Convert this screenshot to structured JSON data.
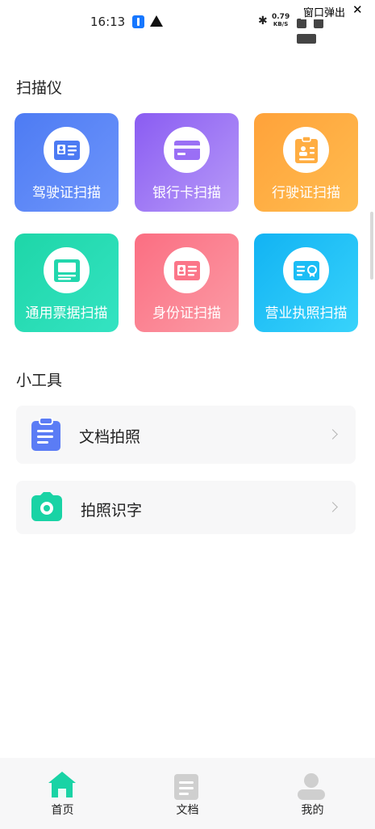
{
  "status_bar": {
    "time": "16:13",
    "net_speed_value": "0.79",
    "net_speed_unit": "KB/S",
    "popup_label": "窗口弹出",
    "popup_close": "✕"
  },
  "scanner_section": {
    "title": "扫描仪",
    "cards": [
      {
        "label": "驾驶证扫描",
        "icon": "driver-license-icon",
        "colors": [
          "#4d7bf3",
          "#6f96fb"
        ]
      },
      {
        "label": "银行卡扫描",
        "icon": "bank-card-icon",
        "colors": [
          "#8a5cf2",
          "#b79af8"
        ]
      },
      {
        "label": "行驶证扫描",
        "icon": "vehicle-license-icon",
        "colors": [
          "#ffa23a",
          "#ffbc4f"
        ]
      },
      {
        "label": "通用票据扫描",
        "icon": "receipt-icon",
        "colors": [
          "#1ed6a8",
          "#34e3c2"
        ]
      },
      {
        "label": "身份证扫描",
        "icon": "id-card-icon",
        "colors": [
          "#fb6e82",
          "#fb9ba5"
        ]
      },
      {
        "label": "营业执照扫描",
        "icon": "business-license-icon",
        "colors": [
          "#12b3f3",
          "#38d3fb"
        ]
      }
    ]
  },
  "tools_section": {
    "title": "小工具",
    "items": [
      {
        "label": "文档拍照",
        "icon": "clipboard-document-icon"
      },
      {
        "label": "拍照识字",
        "icon": "camera-icon"
      }
    ]
  },
  "tabbar": {
    "tabs": [
      {
        "label": "首页",
        "icon": "home-icon",
        "active": true
      },
      {
        "label": "文档",
        "icon": "document-icon",
        "active": false
      },
      {
        "label": "我的",
        "icon": "profile-icon",
        "active": false
      }
    ]
  },
  "colors": {
    "accent_green": "#19d3a5",
    "inactive_gray": "#cfcfcf",
    "tool_blue": "#5b7cf5"
  }
}
